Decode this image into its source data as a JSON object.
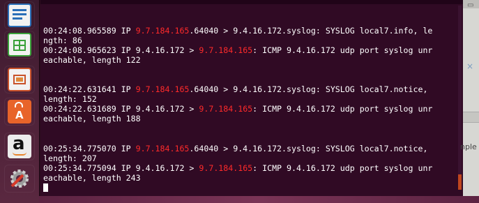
{
  "launcher": {
    "items": [
      {
        "name": "libreoffice-writer",
        "color": "#2a6fb8"
      },
      {
        "name": "libreoffice-calc",
        "color": "#3aa13a"
      },
      {
        "name": "libreoffice-impress",
        "color": "#c9522a"
      },
      {
        "name": "ubuntu-software-center",
        "color": "#e8642a"
      },
      {
        "name": "amazon",
        "glyph": "a",
        "color": "#e8e8e8"
      },
      {
        "name": "system-settings",
        "color": "#8a8a8a"
      }
    ]
  },
  "terminal": {
    "ip_color": "#ff2a2a",
    "lines": [
      {
        "segments": [
          {
            "t": "00:24:08.965589 IP "
          },
          {
            "t": "9.7.184.165",
            "hl": true
          },
          {
            "t": ".64040 > 9.4.16.172.syslog: SYSLOG local7.info, le"
          }
        ]
      },
      {
        "segments": [
          {
            "t": "ngth: 86"
          }
        ]
      },
      {
        "segments": [
          {
            "t": "00:24:08.965623 IP 9.4.16.172 > "
          },
          {
            "t": "9.7.184.165",
            "hl": true
          },
          {
            "t": ": ICMP 9.4.16.172 udp port syslog unr"
          }
        ]
      },
      {
        "segments": [
          {
            "t": "eachable, length 122"
          }
        ]
      },
      {
        "segments": [
          {
            "t": "00:24:22.631641 IP "
          },
          {
            "t": "9.7.184.165",
            "hl": true
          },
          {
            "t": ".64040 > 9.4.16.172.syslog: SYSLOG local7.notice,"
          }
        ]
      },
      {
        "segments": [
          {
            "t": "length: 152"
          }
        ]
      },
      {
        "segments": [
          {
            "t": "00:24:22.631689 IP 9.4.16.172 > "
          },
          {
            "t": "9.7.184.165",
            "hl": true
          },
          {
            "t": ": ICMP 9.4.16.172 udp port syslog unr"
          }
        ]
      },
      {
        "segments": [
          {
            "t": "eachable, length 188"
          }
        ]
      },
      {
        "segments": [
          {
            "t": "00:25:34.775070 IP "
          },
          {
            "t": "9.7.184.165",
            "hl": true
          },
          {
            "t": ".64040 > 9.4.16.172.syslog: SYSLOG local7.notice,"
          }
        ]
      },
      {
        "segments": [
          {
            "t": "length: 207"
          }
        ]
      },
      {
        "segments": [
          {
            "t": "00:25:34.775094 IP 9.4.16.172 > "
          },
          {
            "t": "9.7.184.165",
            "hl": true
          },
          {
            "t": ": ICMP 9.4.16.172 udp port syslog unr"
          }
        ]
      },
      {
        "segments": [
          {
            "t": "eachable, length 243"
          }
        ]
      }
    ]
  },
  "background_window": {
    "partial_text": "nple"
  }
}
